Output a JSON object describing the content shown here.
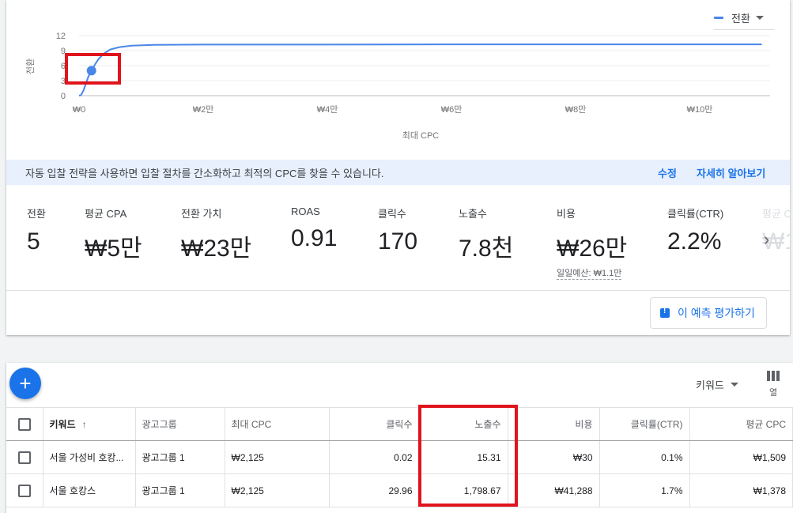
{
  "legend": {
    "label": "전환"
  },
  "chart_data": {
    "type": "line",
    "ylabel": "전환",
    "xlabel": "최대 CPC",
    "y_ticks": [
      "12",
      "9",
      "6",
      "3",
      "0"
    ],
    "x_ticks": [
      "₩0",
      "₩2만",
      "₩4만",
      "₩6만",
      "₩8만",
      "₩10만"
    ],
    "ylim": [
      0,
      12
    ],
    "xlim": [
      0,
      112000
    ],
    "series": [
      {
        "x": [
          0,
          300,
          700,
          1100,
          1500,
          2000,
          2600,
          3200,
          4000,
          5000,
          6500,
          8500,
          12000,
          20000,
          40000,
          60000,
          80000,
          100000,
          112000
        ],
        "y": [
          0,
          0.1,
          1.0,
          2.4,
          3.8,
          5.0,
          6.3,
          7.4,
          8.4,
          9.2,
          9.7,
          10.0,
          10.15,
          10.2,
          10.2,
          10.25,
          10.25,
          10.25,
          10.25
        ]
      }
    ],
    "marker": {
      "x": 2000,
      "y": 5
    },
    "color": "#4a86e8"
  },
  "info": {
    "text": "자동 입찰 전략을 사용하면 입찰 절차를 간소화하고 최적의 CPC를 찾을 수 있습니다.",
    "link_edit": "수정",
    "link_learn": "자세히 알아보기"
  },
  "metrics": [
    {
      "label": "전환",
      "value": "5"
    },
    {
      "label": "평균 CPA",
      "value": "₩5만"
    },
    {
      "label": "전환 가치",
      "value": "₩23만"
    },
    {
      "label": "ROAS",
      "value": "0.91"
    },
    {
      "label": "클릭수",
      "value": "170"
    },
    {
      "label": "노출수",
      "value": "7.8천"
    },
    {
      "label": "비용",
      "value": "₩26만",
      "sub": "일일예산: ₩1.1만"
    },
    {
      "label": "클릭률(CTR)",
      "value": "2.2%"
    },
    {
      "label": "평균 C",
      "value": "₩1"
    }
  ],
  "chevron": "›",
  "eval_button": "이 예측 평가하기",
  "table_toolbar": {
    "fab": "+",
    "segment": "키워드",
    "columns_label": "열"
  },
  "table": {
    "headers": [
      "키워드",
      "광고그룹",
      "최대 CPC",
      "클릭수",
      "노출수",
      "비용",
      "클릭률(CTR)",
      "평균 CPC"
    ],
    "sort_indicator": "↑",
    "rows": [
      [
        "서울 가성비 호캉...",
        "광고그룹 1",
        "₩2,125",
        "0.02",
        "15.31",
        "₩30",
        "0.1%",
        "₩1,509"
      ],
      [
        "서울 호캉스",
        "광고그룹 1",
        "₩2,125",
        "29.96",
        "1,798.67",
        "₩41,288",
        "1.7%",
        "₩1,378"
      ]
    ]
  },
  "colors": {
    "accent": "#1a73e8",
    "highlight": "#e0141c",
    "series": "#4a86e8"
  }
}
